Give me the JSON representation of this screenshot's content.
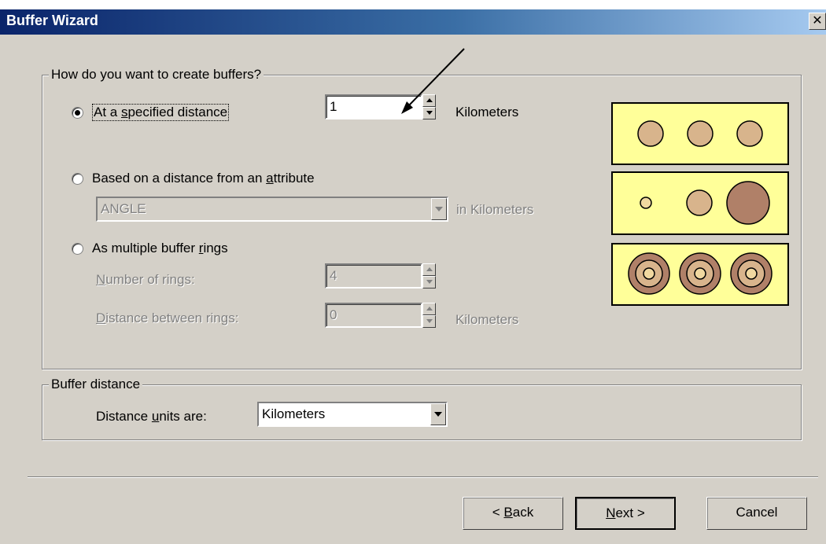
{
  "window": {
    "title": "Buffer Wizard",
    "close_glyph": "✕"
  },
  "create_group": {
    "legend": "How do you want to create buffers?",
    "option_distance": {
      "label_pre": "At a ",
      "label_key": "s",
      "label_post": "pecified distance",
      "selected": true,
      "value": "1",
      "unit": "Kilometers"
    },
    "option_attribute": {
      "label_pre": "Based on a distance from an ",
      "label_key": "a",
      "label_post": "ttribute",
      "selected": false,
      "field_value": "ANGLE",
      "unit": "in Kilometers"
    },
    "option_rings": {
      "label_pre": "As multiple buffer ",
      "label_key": "r",
      "label_post": "ings",
      "selected": false,
      "num_rings_key": "N",
      "num_rings_label": "umber of rings:",
      "num_rings_value": "4",
      "dist_key": "D",
      "dist_label": "istance between rings:",
      "dist_value": "0",
      "dist_unit": "Kilometers"
    }
  },
  "buffer_distance": {
    "legend": "Buffer distance",
    "label_pre": "Distance ",
    "label_key": "u",
    "label_post": "nits are:",
    "selected_unit": "Kilometers"
  },
  "buttons": {
    "back_pre": "< ",
    "back_key": "B",
    "back_post": "ack",
    "next_key": "N",
    "next_post": "ext >",
    "cancel": "Cancel"
  },
  "colors": {
    "preview_bg": "#ffff99",
    "circle_fill": "#d8b48c",
    "circle_dark": "#b08068"
  }
}
